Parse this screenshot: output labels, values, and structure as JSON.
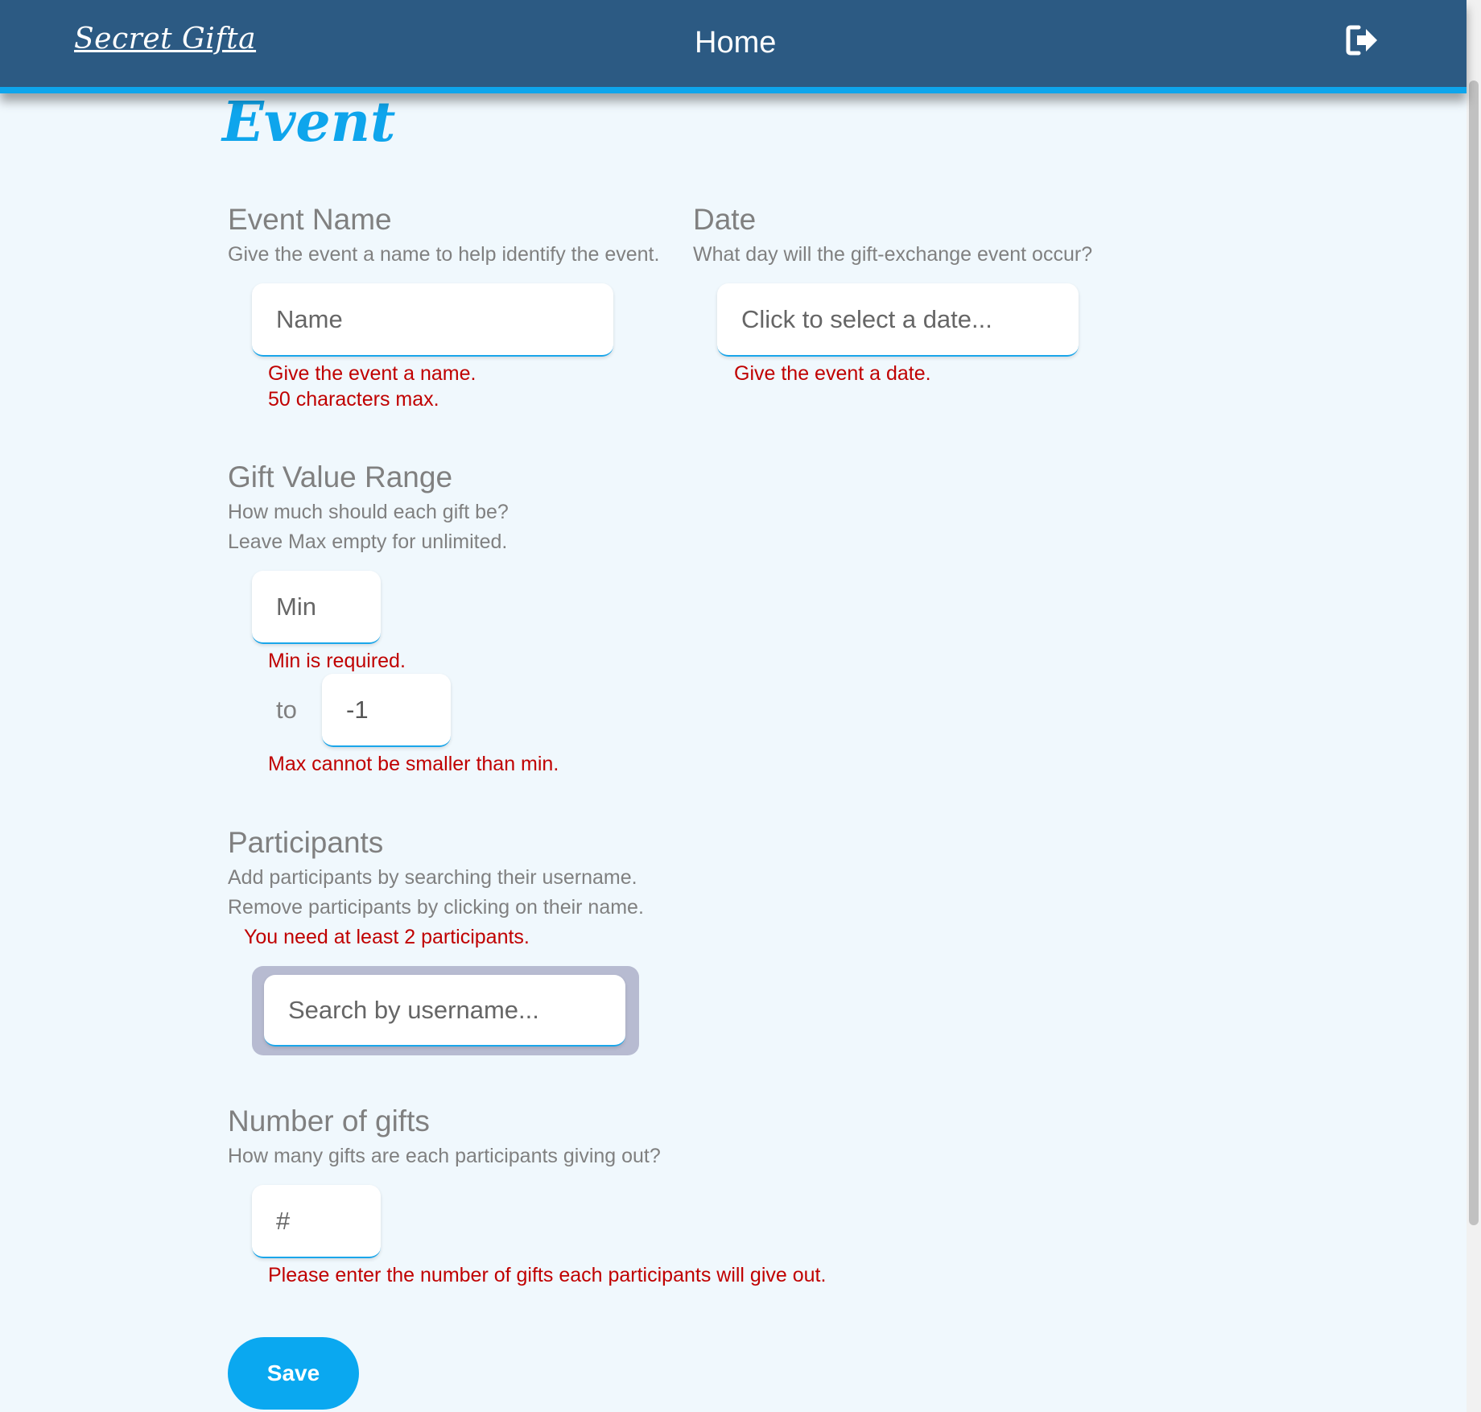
{
  "navbar": {
    "brand": "Secret Gifta",
    "home_label": "Home",
    "logout_icon": "sign-out-icon"
  },
  "page": {
    "title": "Event"
  },
  "event_name": {
    "label": "Event Name",
    "description": "Give the event a name to help identify the event.",
    "placeholder": "Name",
    "errors": [
      "Give the event a name.",
      "50 characters max."
    ]
  },
  "date": {
    "label": "Date",
    "description": "What day will the gift-exchange event occur?",
    "placeholder": "Click to select a date...",
    "error": "Give the event a date."
  },
  "gift_value": {
    "label": "Gift Value Range",
    "description_lines": [
      "How much should each gift be?",
      "Leave Max empty for unlimited."
    ],
    "min_placeholder": "Min",
    "min_error": "Min is required.",
    "to_label": "to",
    "max_value": "-1",
    "max_error": "Max cannot be smaller than min."
  },
  "participants": {
    "label": "Participants",
    "description_lines": [
      "Add participants by searching their username.",
      "Remove participants by clicking on their name."
    ],
    "error": "You need at least 2 participants.",
    "search_placeholder": "Search by username..."
  },
  "gifts": {
    "label": "Number of gifts",
    "description": "How many gifts are each participants giving out?",
    "placeholder": "#",
    "error": "Please enter the number of gifts each participants will give out."
  },
  "actions": {
    "save_label": "Save"
  },
  "colors": {
    "navbar": "#2c5a83",
    "accent": "#0ea5ec",
    "background": "#f0f8fd",
    "error": "#c00000"
  }
}
